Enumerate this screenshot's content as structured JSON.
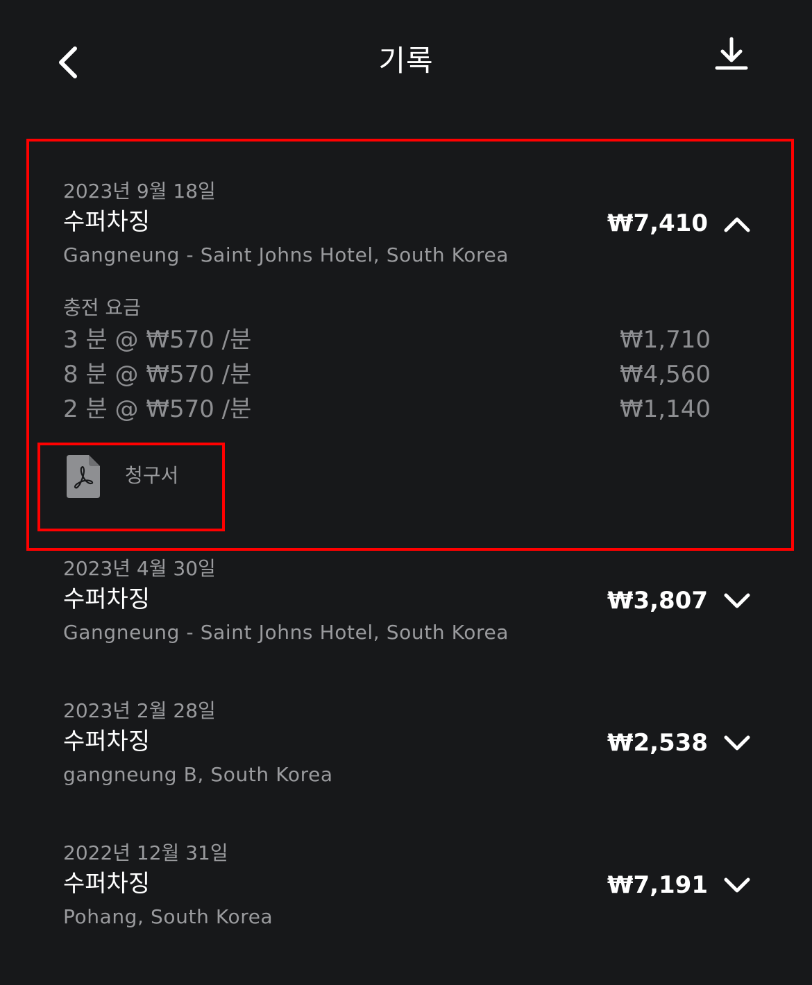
{
  "header": {
    "title": "기록",
    "back_icon": "chevron-left-icon",
    "download_icon": "download-icon"
  },
  "records": [
    {
      "date": "2023년 9월 18일",
      "type": "수퍼차징",
      "location": "Gangneung - Saint Johns Hotel, South Korea",
      "amount": "₩7,410",
      "expanded": true,
      "details": {
        "title": "충전 요금",
        "fees": [
          {
            "desc": "3 분 @ ₩570 /분",
            "amount": "₩1,710"
          },
          {
            "desc": "8 분 @ ₩570 /분",
            "amount": "₩4,560"
          },
          {
            "desc": "2 분 @ ₩570 /분",
            "amount": "₩1,140"
          }
        ],
        "invoice_label": "청구서",
        "invoice_icon": "pdf-icon"
      }
    },
    {
      "date": "2023년 4월 30일",
      "type": "수퍼차징",
      "location": "Gangneung - Saint Johns Hotel, South Korea",
      "amount": "₩3,807",
      "expanded": false
    },
    {
      "date": "2023년 2월 28일",
      "type": "수퍼차징",
      "location": "gangneung B, South Korea",
      "amount": "₩2,538",
      "expanded": false
    },
    {
      "date": "2022년 12월 31일",
      "type": "수퍼차징",
      "location": "Pohang, South Korea",
      "amount": "₩7,191",
      "expanded": false
    }
  ],
  "colors": {
    "background": "#17181a",
    "primary_text": "#ffffff",
    "secondary_text": "#9a9b9e",
    "highlight": "#ff0000"
  }
}
